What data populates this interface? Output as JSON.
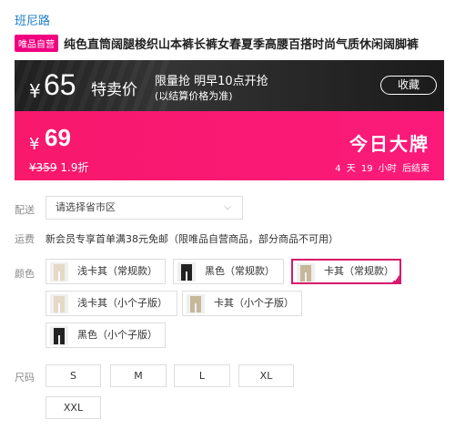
{
  "brand": "班尼路",
  "vip_tag": "唯品自营",
  "product_title": "纯色直筒阔腿梭织山本裤长裤女春夏季高腰百搭时尚气质休闲阔脚裤",
  "promo": {
    "currency": "¥",
    "special_price": "65",
    "special_label": "特卖价",
    "flash_line1": "限量抢 明早10点开抢",
    "flash_line2": "(以结算价格为准)",
    "favorite_label": "收藏",
    "current_price": "69",
    "original_price": "¥359",
    "discount": "1.9折",
    "big_brand_label": "今日大牌",
    "countdown": "4 天 19 小时 后结束"
  },
  "delivery": {
    "label": "配送",
    "placeholder": "请选择省市区",
    "chevron": "⌵"
  },
  "shipping": {
    "label": "运费",
    "text": "新会员专享首单满38元免邮（限唯品自营商品，部分商品不可用）"
  },
  "colors": {
    "label": "颜色",
    "options": [
      {
        "label": "浅卡其（常规款）"
      },
      {
        "label": "黑色（常规款）"
      },
      {
        "label": "卡其（常规款）"
      },
      {
        "label": "浅卡其（小个子版）"
      },
      {
        "label": "卡其（小个子版）"
      },
      {
        "label": "黑色（小个子版）"
      }
    ],
    "selected_check": "✓"
  },
  "sizes": {
    "label": "尺码",
    "options": [
      "S",
      "M",
      "L",
      "XL",
      "XXL"
    ]
  },
  "theme": {
    "accent": "#f10180",
    "brand_link": "#1a7dc8",
    "selected_border": "#d8176d"
  }
}
